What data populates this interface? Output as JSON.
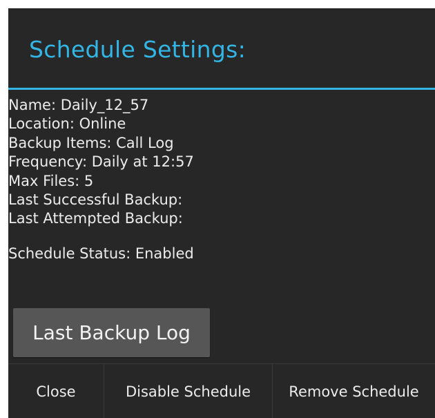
{
  "dialog": {
    "title": "Schedule Settings:",
    "accent_color": "#33b5e5",
    "background_color": "#272727"
  },
  "info": {
    "name": "Name: Daily_12_57",
    "location": "Location: Online",
    "backup_items": "Backup Items: Call Log",
    "frequency": "Frequency: Daily at 12:57",
    "max_files": "Max Files: 5",
    "last_successful": "Last Successful Backup:",
    "last_attempted": "Last Attempted Backup:",
    "status": "Schedule Status: Enabled"
  },
  "buttons": {
    "last_backup_log": "Last Backup Log",
    "close": "Close",
    "disable_schedule": "Disable Schedule",
    "remove_schedule": "Remove Schedule"
  }
}
